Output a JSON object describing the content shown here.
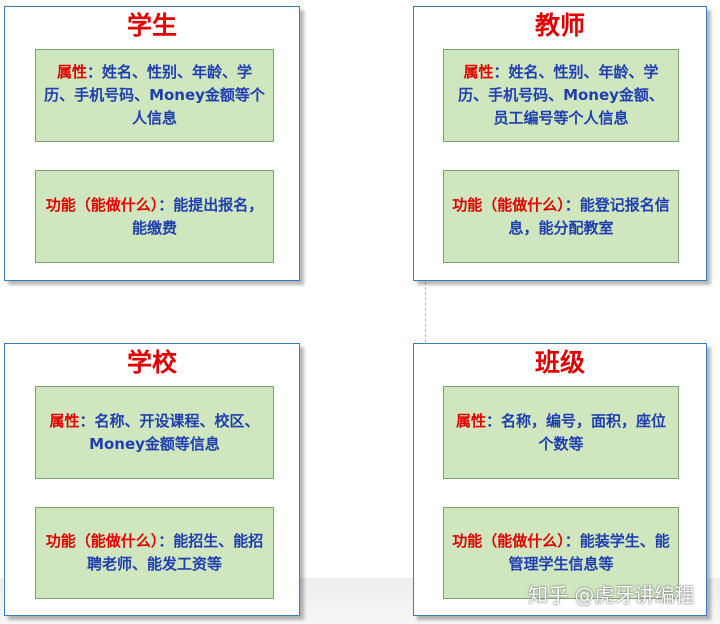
{
  "cards": {
    "student": {
      "title": "学生",
      "attr_label": "属性",
      "attr_sep": "：",
      "attr_text": "姓名、性别、年龄、学历、手机号码、Money金额等个人信息",
      "func_label": "功能（能做什么）",
      "func_sep": "：",
      "func_text": "能提出报名，能缴费"
    },
    "teacher": {
      "title": "教师",
      "attr_label": "属性",
      "attr_sep": "：",
      "attr_text": "姓名、性别、年龄、学历、手机号码、Money金额、员工编号等个人信息",
      "func_label": "功能（能做什么）",
      "func_sep": "：",
      "func_text": "能登记报名信息，能分配教室"
    },
    "school": {
      "title": "学校",
      "attr_label": "属性",
      "attr_sep": "：",
      "attr_text": "名称、开设课程、校区、Money金额等信息",
      "func_label": "功能（能做什么）",
      "func_sep": "：",
      "func_text": "能招生、能招聘老师、能发工资等"
    },
    "class": {
      "title": "班级",
      "attr_label": "属性",
      "attr_sep": "：",
      "attr_text": "名称，编号，面积，座位个数等",
      "func_label": "功能（能做什么）",
      "func_sep": "：",
      "func_text": "能装学生、能管理学生信息等"
    }
  },
  "watermark": "知乎 @虎牙讲编程"
}
